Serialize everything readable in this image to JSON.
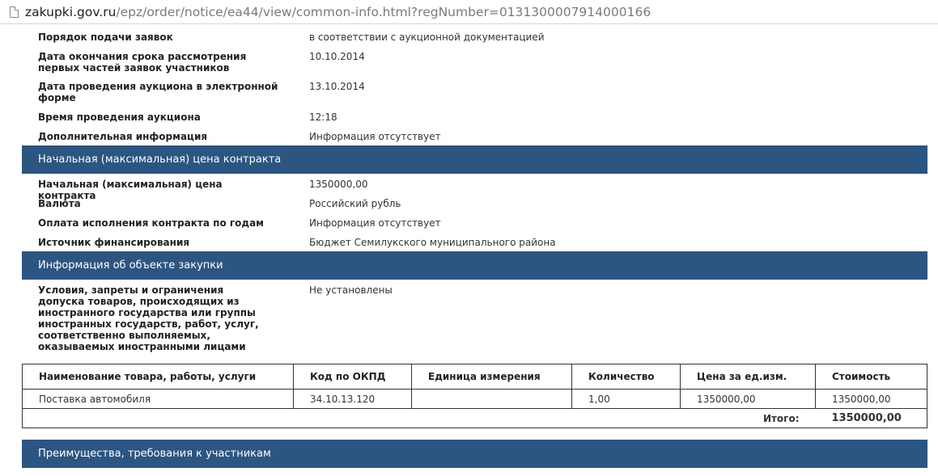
{
  "browser": {
    "url_host": "zakupki.gov.ru",
    "url_path": "/epz/order/notice/ea44/view/common-info.html?regNumber=0131300007914000166"
  },
  "auction_info": [
    {
      "label": "Порядок подачи заявок",
      "value": "в соответствии с аукционной документацией"
    },
    {
      "label": "Дата окончания срока рассмотрения первых частей заявок участников",
      "value": "10.10.2014"
    },
    {
      "label": "Дата проведения аукциона в электронной форме",
      "value": "13.10.2014"
    },
    {
      "label": "Время проведения аукциона",
      "value": "12:18"
    },
    {
      "label": "Дополнительная информация",
      "value": "Информация отсутствует"
    }
  ],
  "sections": {
    "price": "Начальная (максимальная) цена контракта",
    "object": "Информация об объекте закупки",
    "advantages": "Преимущества, требования к участникам"
  },
  "price_info": [
    {
      "label": "Начальная (максимальная) цена контракта",
      "value": "1350000,00"
    },
    {
      "label": "Валюта",
      "value": "Российский рубль"
    },
    {
      "label": "Оплата исполнения контракта по годам",
      "value": "Информация отсутствует"
    },
    {
      "label": "Источник финансирования",
      "value": "Бюджет Семилукского муниципального района"
    }
  ],
  "object_info": [
    {
      "label": "Условия, запреты и ограничения допуска товаров, происходящих из иностранного государства или группы иностранных государств, работ, услуг, соответственно выполняемых, оказываемых иностранными лицами",
      "value": "Не установлены"
    }
  ],
  "items_table": {
    "headers": [
      "Наименование товара, работы, услуги",
      "Код по ОКПД",
      "Единица измерения",
      "Количество",
      "Цена за ед.изм.",
      "Стоимость"
    ],
    "rows": [
      [
        "Поставка автомобиля",
        "34.10.13.120",
        "",
        "1,00",
        "1350000,00",
        "1350000,00"
      ]
    ],
    "total_label": "Итого:",
    "total_value": "1350000,00"
  },
  "colors": {
    "section_bar": "#2d5581"
  }
}
